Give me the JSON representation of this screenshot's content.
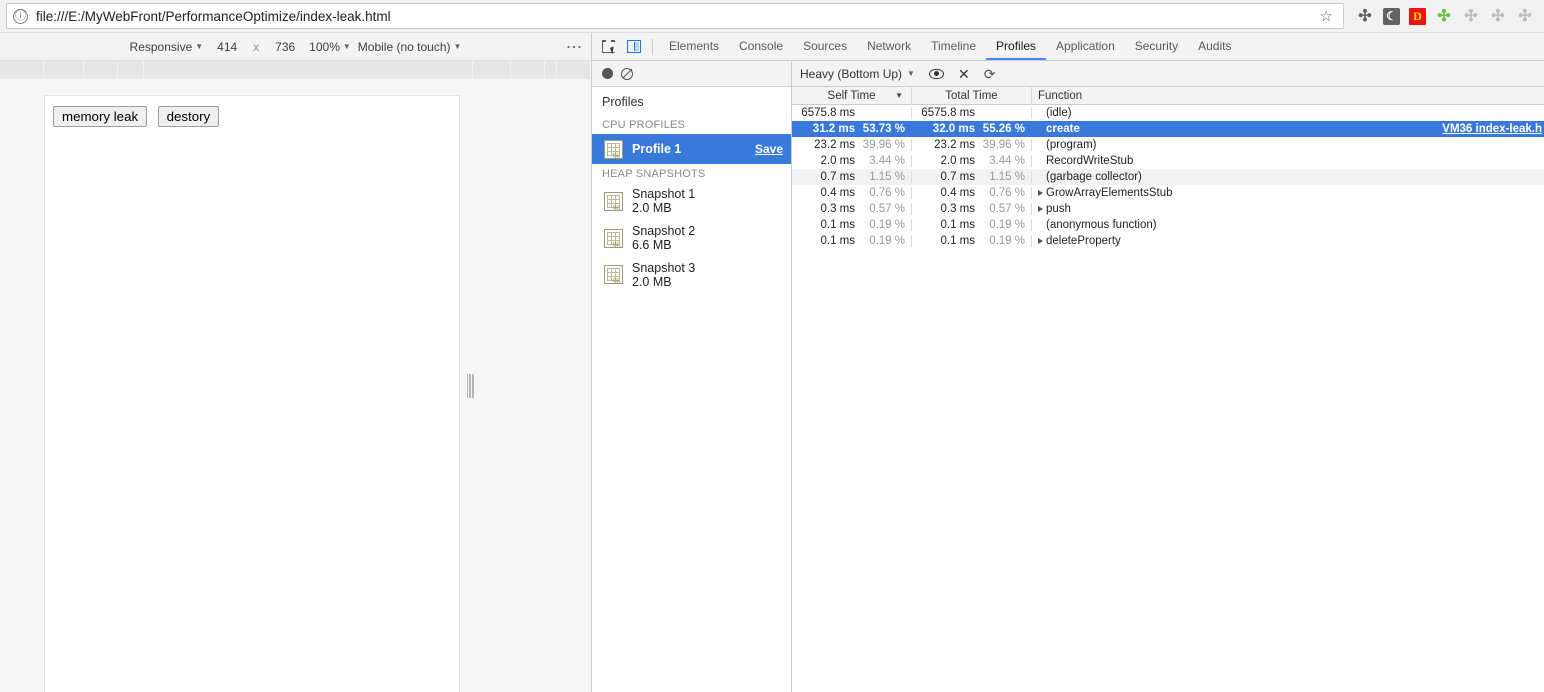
{
  "browser": {
    "url": "file:///E:/MyWebFront/PerformanceOptimize/index-leak.html",
    "info_icon": "ⓘ",
    "star_icon": "☆",
    "extensions": [
      {
        "name": "puzzle-extension-icon",
        "glyph": "🧩",
        "kind": "puzzle-dark"
      },
      {
        "name": "dark-reader-extension-icon",
        "glyph": "☾",
        "kind": "moon"
      },
      {
        "name": "d-extension-icon",
        "glyph": "D",
        "kind": "d-red"
      },
      {
        "name": "green-extension-icon",
        "glyph": "🧩",
        "kind": "puzzle-green"
      },
      {
        "name": "puzzle-extension-icon-2",
        "glyph": "🧩",
        "kind": "puzzle-light"
      },
      {
        "name": "puzzle-extension-icon-3",
        "glyph": "🧩",
        "kind": "puzzle-light"
      },
      {
        "name": "puzzle-extension-icon-4",
        "glyph": "🧩",
        "kind": "puzzle-light"
      }
    ]
  },
  "device_toolbar": {
    "device_label": "Responsive",
    "width": "414",
    "x_label": "x",
    "height": "736",
    "zoom": "100%",
    "throttle": "Mobile (no touch)",
    "caret": "▼",
    "menu_glyph": "⋮"
  },
  "page": {
    "buttons": [
      {
        "label": "memory leak",
        "name": "memory-leak-button"
      },
      {
        "label": "destory",
        "name": "destroy-button"
      }
    ]
  },
  "devtools": {
    "tabs": [
      {
        "label": "Elements",
        "active": false
      },
      {
        "label": "Console",
        "active": false
      },
      {
        "label": "Sources",
        "active": false
      },
      {
        "label": "Network",
        "active": false
      },
      {
        "label": "Timeline",
        "active": false
      },
      {
        "label": "Profiles",
        "active": true
      },
      {
        "label": "Application",
        "active": false
      },
      {
        "label": "Security",
        "active": false
      },
      {
        "label": "Audits",
        "active": false
      }
    ],
    "subbar": {
      "view_mode": "Heavy (Bottom Up)",
      "caret": "▼",
      "x_glyph": "✕",
      "refresh_glyph": "⟳"
    },
    "accent_color": "#3879d9",
    "tab_underline_color": "#4285f4"
  },
  "profiles_sidebar": {
    "title": "Profiles",
    "sections": [
      {
        "heading": "CPU PROFILES",
        "items": [
          {
            "name": "Profile 1",
            "size": "",
            "selected": true,
            "action": "Save"
          }
        ]
      },
      {
        "heading": "HEAP SNAPSHOTS",
        "items": [
          {
            "name": "Snapshot 1",
            "size": "2.0 MB",
            "selected": false,
            "action": ""
          },
          {
            "name": "Snapshot 2",
            "size": "6.6 MB",
            "selected": false,
            "action": ""
          },
          {
            "name": "Snapshot 3",
            "size": "2.0 MB",
            "selected": false,
            "action": ""
          }
        ]
      }
    ]
  },
  "profile_grid": {
    "columns": [
      "Self Time",
      "Total Time",
      "Function"
    ],
    "sort_caret": "▼",
    "rows": [
      {
        "self_ms": "6575.8 ms",
        "self_pct": "",
        "total_ms": "6575.8 ms",
        "total_pct": "",
        "function": "(idle)",
        "expandable": false,
        "selected": false,
        "alt": false,
        "link": ""
      },
      {
        "self_ms": "31.2 ms",
        "self_pct": "53.73 %",
        "total_ms": "32.0 ms",
        "total_pct": "55.26 %",
        "function": "create",
        "expandable": false,
        "selected": true,
        "alt": false,
        "link": "VM36 index-leak.h"
      },
      {
        "self_ms": "23.2 ms",
        "self_pct": "39.96 %",
        "total_ms": "23.2 ms",
        "total_pct": "39.96 %",
        "function": "(program)",
        "expandable": false,
        "selected": false,
        "alt": false,
        "link": ""
      },
      {
        "self_ms": "2.0 ms",
        "self_pct": "3.44 %",
        "total_ms": "2.0 ms",
        "total_pct": "3.44 %",
        "function": "RecordWriteStub",
        "expandable": false,
        "selected": false,
        "alt": false,
        "link": ""
      },
      {
        "self_ms": "0.7 ms",
        "self_pct": "1.15 %",
        "total_ms": "0.7 ms",
        "total_pct": "1.15 %",
        "function": "(garbage collector)",
        "expandable": false,
        "selected": false,
        "alt": true,
        "link": ""
      },
      {
        "self_ms": "0.4 ms",
        "self_pct": "0.76 %",
        "total_ms": "0.4 ms",
        "total_pct": "0.76 %",
        "function": "GrowArrayElementsStub",
        "expandable": true,
        "selected": false,
        "alt": false,
        "link": ""
      },
      {
        "self_ms": "0.3 ms",
        "self_pct": "0.57 %",
        "total_ms": "0.3 ms",
        "total_pct": "0.57 %",
        "function": "push",
        "expandable": true,
        "selected": false,
        "alt": false,
        "link": ""
      },
      {
        "self_ms": "0.1 ms",
        "self_pct": "0.19 %",
        "total_ms": "0.1 ms",
        "total_pct": "0.19 %",
        "function": "(anonymous function)",
        "expandable": false,
        "selected": false,
        "alt": false,
        "link": ""
      },
      {
        "self_ms": "0.1 ms",
        "self_pct": "0.19 %",
        "total_ms": "0.1 ms",
        "total_pct": "0.19 %",
        "function": "deleteProperty",
        "expandable": true,
        "selected": false,
        "alt": false,
        "link": ""
      }
    ]
  }
}
